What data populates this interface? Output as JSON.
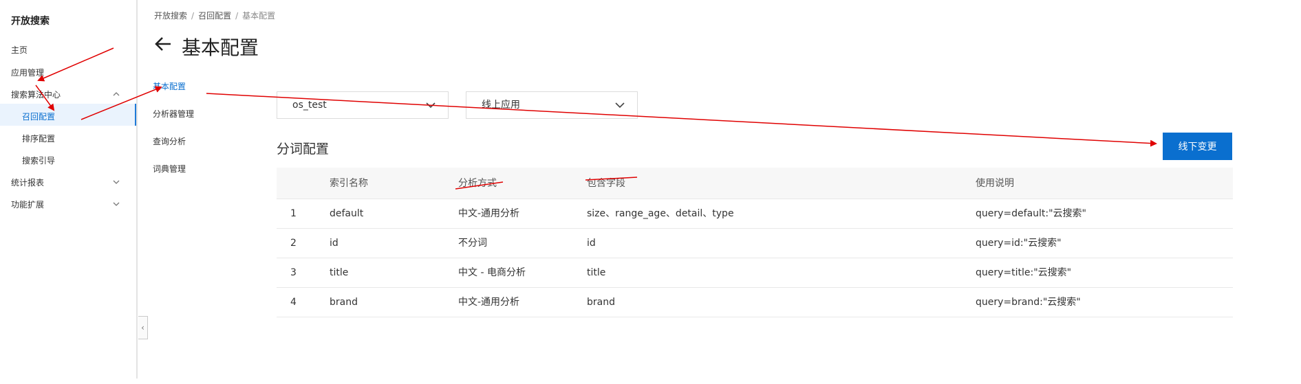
{
  "sidebar": {
    "title": "开放搜索",
    "items": [
      {
        "label": "主页"
      },
      {
        "label": "应用管理"
      },
      {
        "label": "搜索算法中心"
      },
      {
        "label": "召回配置"
      },
      {
        "label": "排序配置"
      },
      {
        "label": "搜索引导"
      },
      {
        "label": "统计报表"
      },
      {
        "label": "功能扩展"
      }
    ]
  },
  "subnav": {
    "items": [
      {
        "label": "基本配置"
      },
      {
        "label": "分析器管理"
      },
      {
        "label": "查询分析"
      },
      {
        "label": "词典管理"
      }
    ]
  },
  "breadcrumb": [
    "开放搜索",
    "召回配置",
    "基本配置"
  ],
  "page_title": "基本配置",
  "selects": {
    "app_value": "os_test",
    "env_value": "线上应用"
  },
  "section_title": "分词配置",
  "action_button": "线下变更",
  "table": {
    "headers": [
      "索引名称",
      "分析方式",
      "包含字段",
      "使用说明"
    ],
    "rows": [
      {
        "no": "1",
        "name": "default",
        "analyzer": "中文-通用分析",
        "fields": "size、range_age、detail、type",
        "usage": "query=default:\"云搜索\""
      },
      {
        "no": "2",
        "name": "id",
        "analyzer": "不分词",
        "fields": "id",
        "usage": "query=id:\"云搜索\""
      },
      {
        "no": "3",
        "name": "title",
        "analyzer": "中文 - 电商分析",
        "fields": "title",
        "usage": "query=title:\"云搜索\""
      },
      {
        "no": "4",
        "name": "brand",
        "analyzer": "中文-通用分析",
        "fields": "brand",
        "usage": "query=brand:\"云搜索\""
      }
    ]
  },
  "icons": {
    "back": "arrow-left-icon",
    "collapse": "chevron-left-icon",
    "expand": "chevron-down-icon",
    "expanded": "chevron-up-icon"
  },
  "colors": {
    "accent": "#0a6fcf",
    "annotation": "#e00000"
  }
}
